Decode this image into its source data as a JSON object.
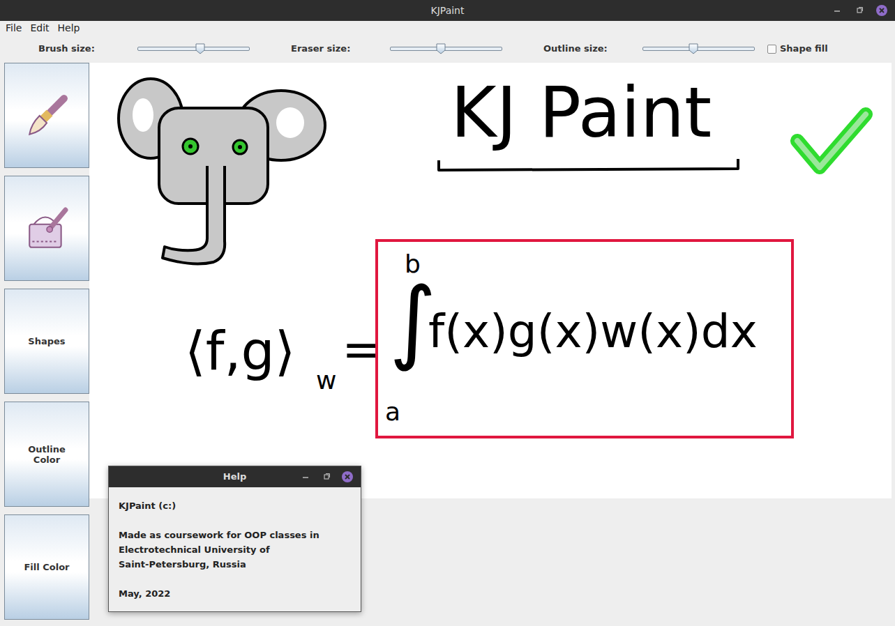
{
  "window": {
    "title": "KJPaint"
  },
  "menu": [
    {
      "label": "File"
    },
    {
      "label": "Edit"
    },
    {
      "label": "Help"
    }
  ],
  "toolbar": {
    "sliders": [
      {
        "label": "Brush size:",
        "level": 0.56
      },
      {
        "label": "Eraser size:",
        "level": 0.45
      },
      {
        "label": "Outline size:",
        "level": 0.45
      }
    ],
    "shape_fill": {
      "label": "Shape fill",
      "checked": false
    }
  },
  "tools": [
    {
      "kind": "icon"
    },
    {
      "kind": "icon"
    },
    {
      "kind": "text",
      "label": "Shapes"
    },
    {
      "kind": "text",
      "label": "Outline Color"
    },
    {
      "kind": "text",
      "label": "Fill Color"
    }
  ],
  "canvas": {
    "heading": "KJ Paint",
    "formula": {
      "lhs": "⟨f,g⟩",
      "subscript": "w",
      "equals": "=",
      "upper": "b",
      "integral": "∫",
      "integrand": "f(x)g(x)w(x)dx",
      "lower": "a"
    }
  },
  "dialog": {
    "title": "Help",
    "paragraphs": [
      [
        "KJPaint (c:)"
      ],
      [
        "Made as coursework for OOP classes in",
        "Electrotechnical University of",
        "Saint-Petersburg, Russia"
      ],
      [
        "May, 2022"
      ]
    ]
  }
}
